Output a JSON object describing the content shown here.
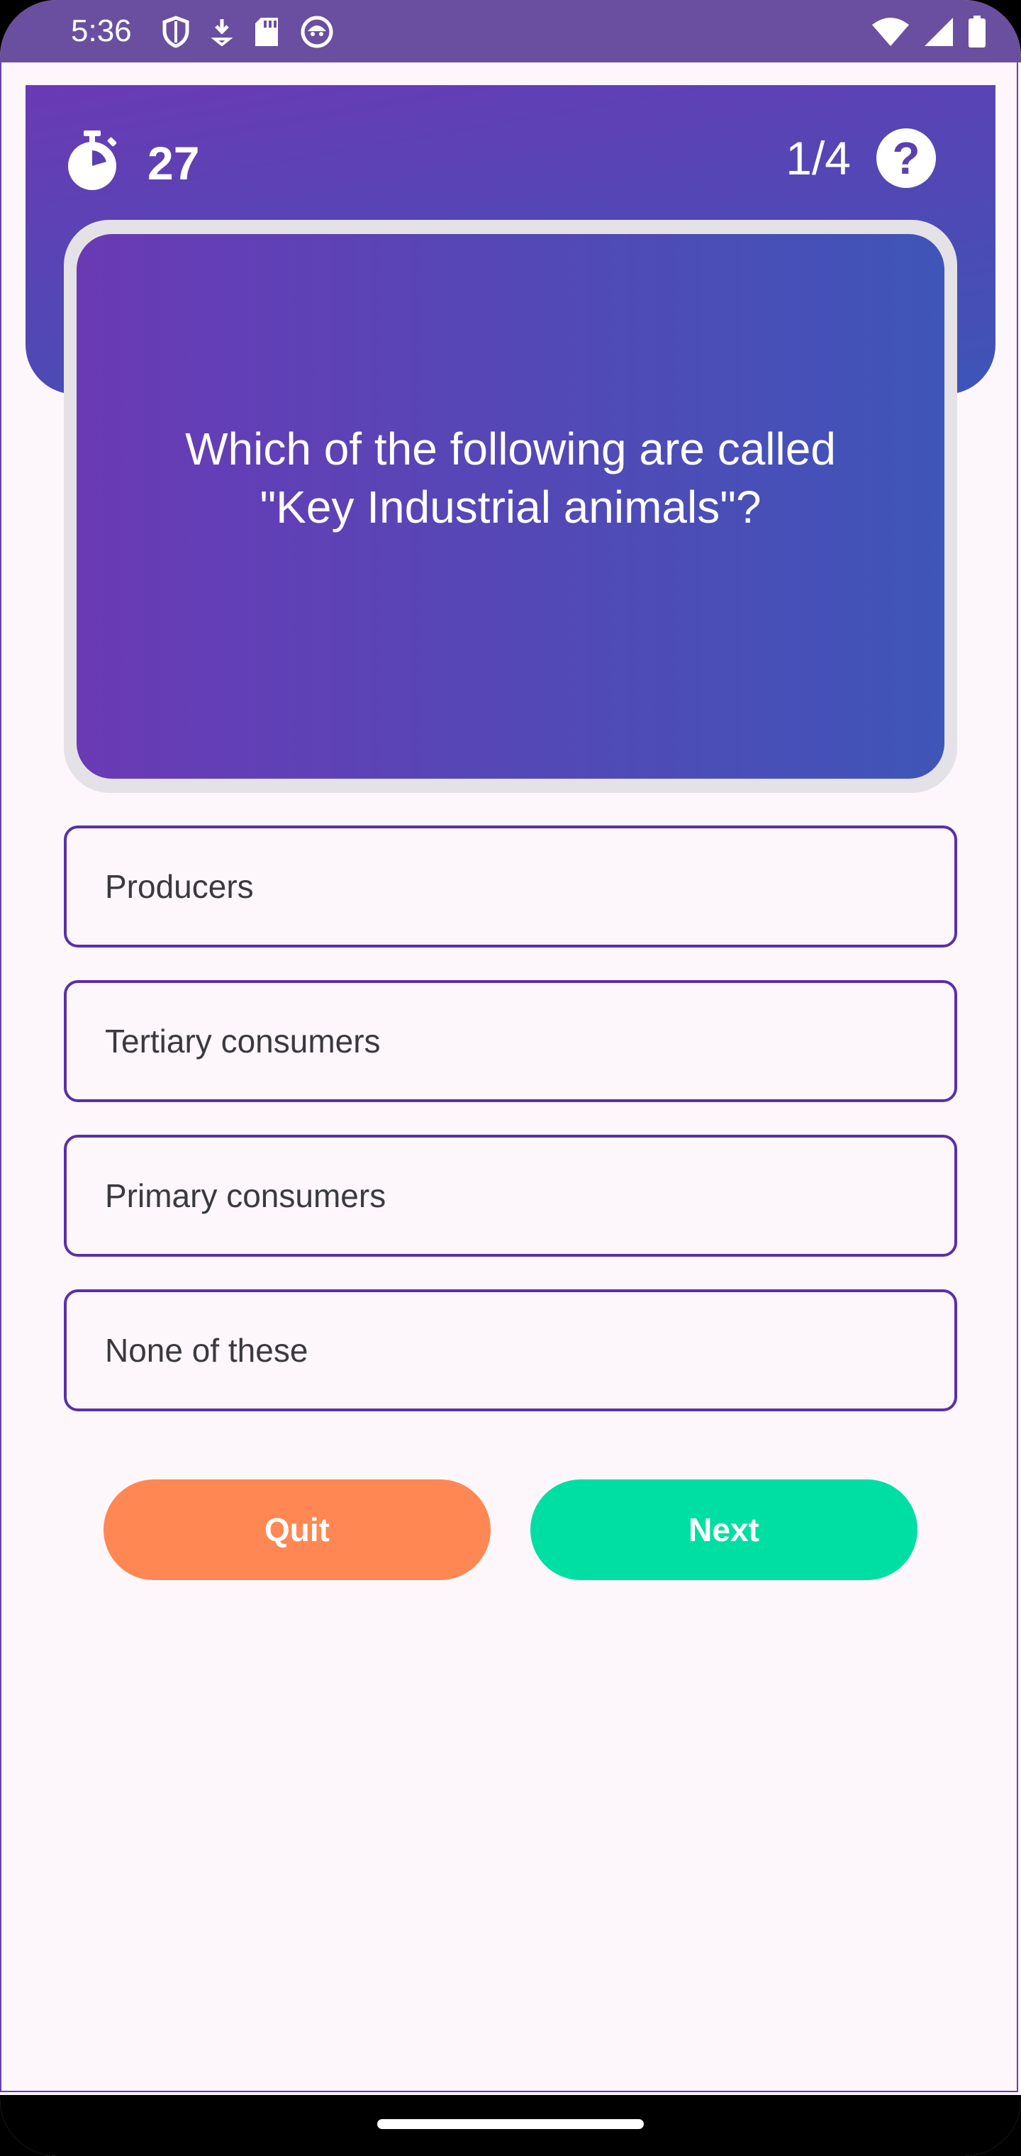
{
  "status_bar": {
    "time": "5:36",
    "left_icons": [
      "shield-icon",
      "download-icon",
      "sd-card-icon",
      "cat-face-icon"
    ],
    "right_icons": [
      "wifi-icon",
      "signal-icon",
      "battery-icon"
    ]
  },
  "header": {
    "timer_icon": "stopwatch-icon",
    "timer_value": "27",
    "progress": "1/4",
    "help_icon": "help-icon",
    "help_glyph": "?"
  },
  "question": {
    "text": "Which of the following are called \"Key Industrial animals\"?"
  },
  "options": [
    {
      "label": "Producers"
    },
    {
      "label": "Tertiary consumers"
    },
    {
      "label": "Primary consumers"
    },
    {
      "label": "None of these"
    }
  ],
  "buttons": {
    "quit_label": "Quit",
    "next_label": "Next"
  },
  "colors": {
    "header_start": "#6a3ab5",
    "header_end": "#3d55b8",
    "option_border": "#5a2fa8",
    "quit": "#ff8753",
    "next": "#00dfa3",
    "background": "#fdf7fb"
  }
}
